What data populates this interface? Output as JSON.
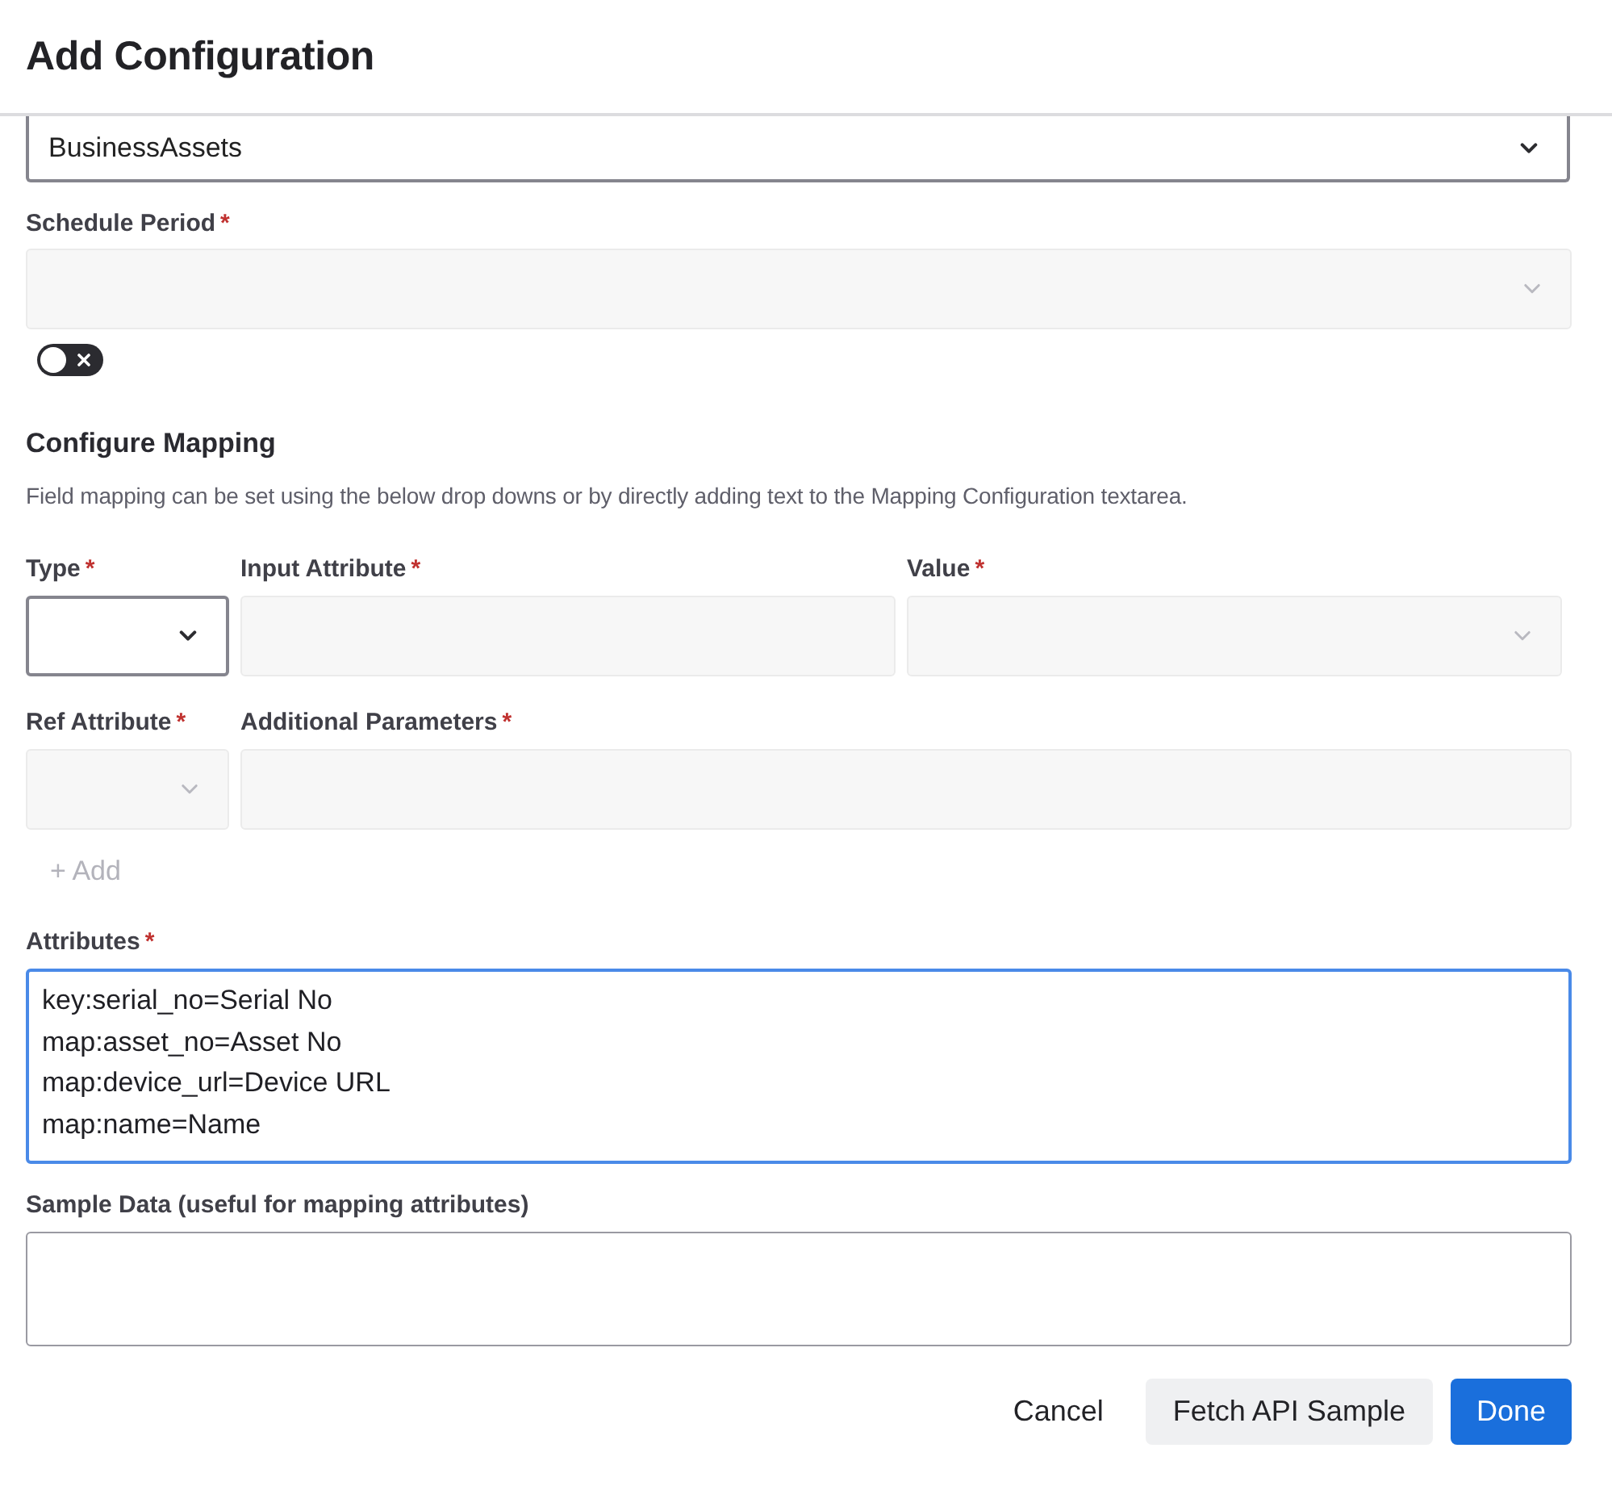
{
  "dialog": {
    "title": "Add Configuration"
  },
  "source_select": {
    "value": "BusinessAssets",
    "disabled": false
  },
  "schedule_period": {
    "label": "Schedule Period",
    "required_mark": "*",
    "disabled": true
  },
  "schedule_toggle": {
    "on": false
  },
  "mapping": {
    "heading": "Configure Mapping",
    "description": "Field mapping can be set using the below drop downs or by directly adding text to the Mapping Configuration textarea.",
    "field_rows": [
      {
        "fields": [
          {
            "label": "Type",
            "required_mark": "*",
            "kind": "select",
            "disabled": false
          },
          {
            "label": "Input Attribute",
            "required_mark": "*",
            "kind": "text",
            "disabled": true
          },
          {
            "label": "Value",
            "required_mark": "*",
            "kind": "select",
            "disabled": true
          }
        ]
      },
      {
        "fields": [
          {
            "label": "Ref Attribute",
            "required_mark": "*",
            "kind": "select",
            "disabled": true
          },
          {
            "label": "Additional Parameters",
            "required_mark": "*",
            "kind": "text",
            "disabled": true
          }
        ]
      }
    ],
    "add_button": {
      "label": "+ Add",
      "disabled": true
    }
  },
  "attributes": {
    "label": "Attributes",
    "required_mark": "*",
    "focused": true,
    "lines": [
      "key:serial_no=Serial No",
      "map:asset_no=Asset No",
      "map:device_url=Device URL",
      "map:name=Name"
    ]
  },
  "sample_data": {
    "label": "Sample Data (useful for mapping attributes)",
    "focused": false
  },
  "buttons": [
    {
      "label": "Cancel",
      "kind": "text"
    },
    {
      "label": "Fetch API Sample",
      "kind": "secondary"
    },
    {
      "label": "Done",
      "kind": "primary"
    }
  ]
}
